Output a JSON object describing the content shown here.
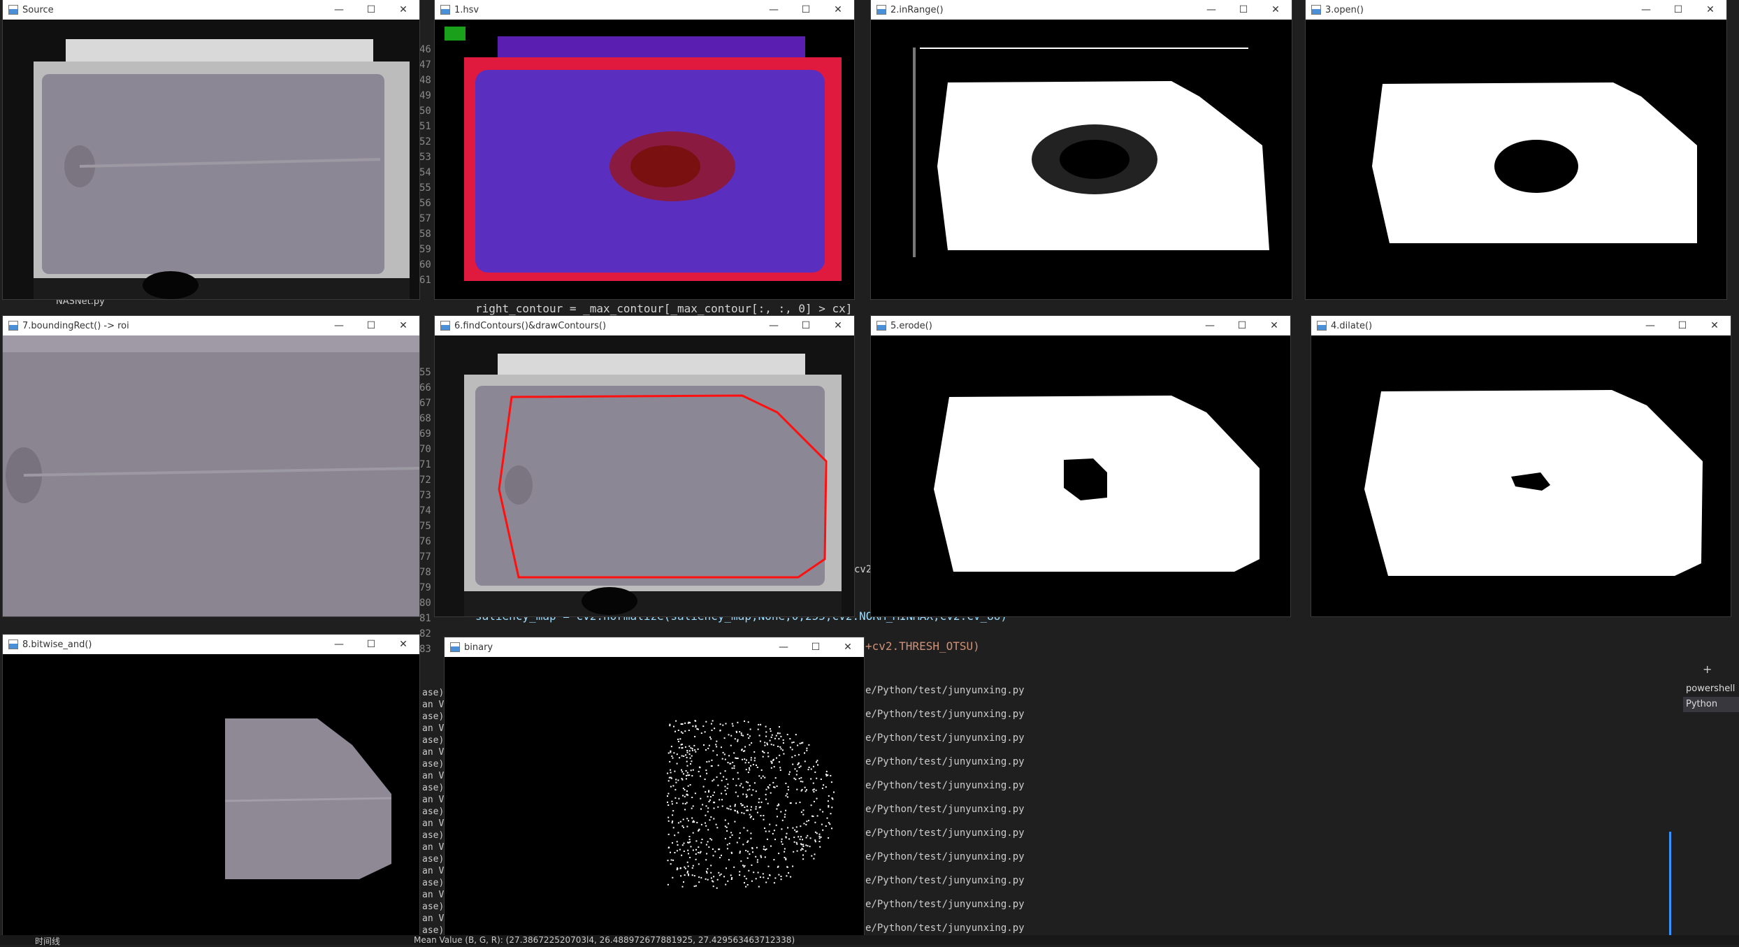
{
  "windows": {
    "source": {
      "title": "Source"
    },
    "hsv": {
      "title": "1.hsv"
    },
    "inrange": {
      "title": "2.inRange()"
    },
    "open": {
      "title": "3.open()"
    },
    "dilate": {
      "title": "4.dilate()"
    },
    "erode": {
      "title": "5.erode()"
    },
    "contours": {
      "title": "6.findContours()&drawContours()"
    },
    "roi": {
      "title": "7.boundingRect() -> roi"
    },
    "bitwise": {
      "title": "8.bitwise_and()"
    },
    "binary": {
      "title": "binary"
    }
  },
  "controls": {
    "minimize": "—",
    "maximize": "☐",
    "close": "✕"
  },
  "editor": {
    "line_numbers": [
      "46",
      "47",
      "48",
      "49",
      "50",
      "51",
      "52",
      "53",
      "54",
      "55",
      "56",
      "57",
      "58",
      "59",
      "60",
      "61"
    ],
    "line_numbers_lower": [
      "55",
      "66",
      "67",
      "68",
      "69",
      "70",
      "71",
      "72",
      "73",
      "74",
      "75",
      "76",
      "77",
      "78",
      "79",
      "80",
      "81",
      "82",
      "83"
    ],
    "code_right_contour": "right_contour = _max_contour[_max_contour[:, :, 0] > cx]",
    "code_saliency": "saliency_map = cv2.normalize(saliency_map,None,0,255,cv2.NORM_MINMAX,cv2.CV_8U)",
    "code_thresh": "+cv2.THRESH_OTSU)",
    "code_fragment_cv2": "cv2",
    "explorer_file": "NASNet.py"
  },
  "terminal": {
    "path_line": "e/Python/test/junyunxing.py",
    "left_fragments": [
      "ase)",
      "an Va",
      "ase)",
      "an Va",
      "ase)",
      "an Va",
      "ase)",
      "an Va",
      "ase)",
      "an Va",
      "ase)",
      "an Va",
      "ase)",
      "an Va",
      "ase)",
      "an Va",
      "ase)",
      "an Va",
      "ase)",
      "an Va",
      "ase)"
    ],
    "tabs": [
      "powershell",
      "Python"
    ],
    "add_button": "+"
  },
  "status_bar": {
    "outline": "时间线",
    "mean_value": "Mean Value (B, G, R): (27.386722520703l4, 26.488972677881925, 27.429563463712338)"
  }
}
